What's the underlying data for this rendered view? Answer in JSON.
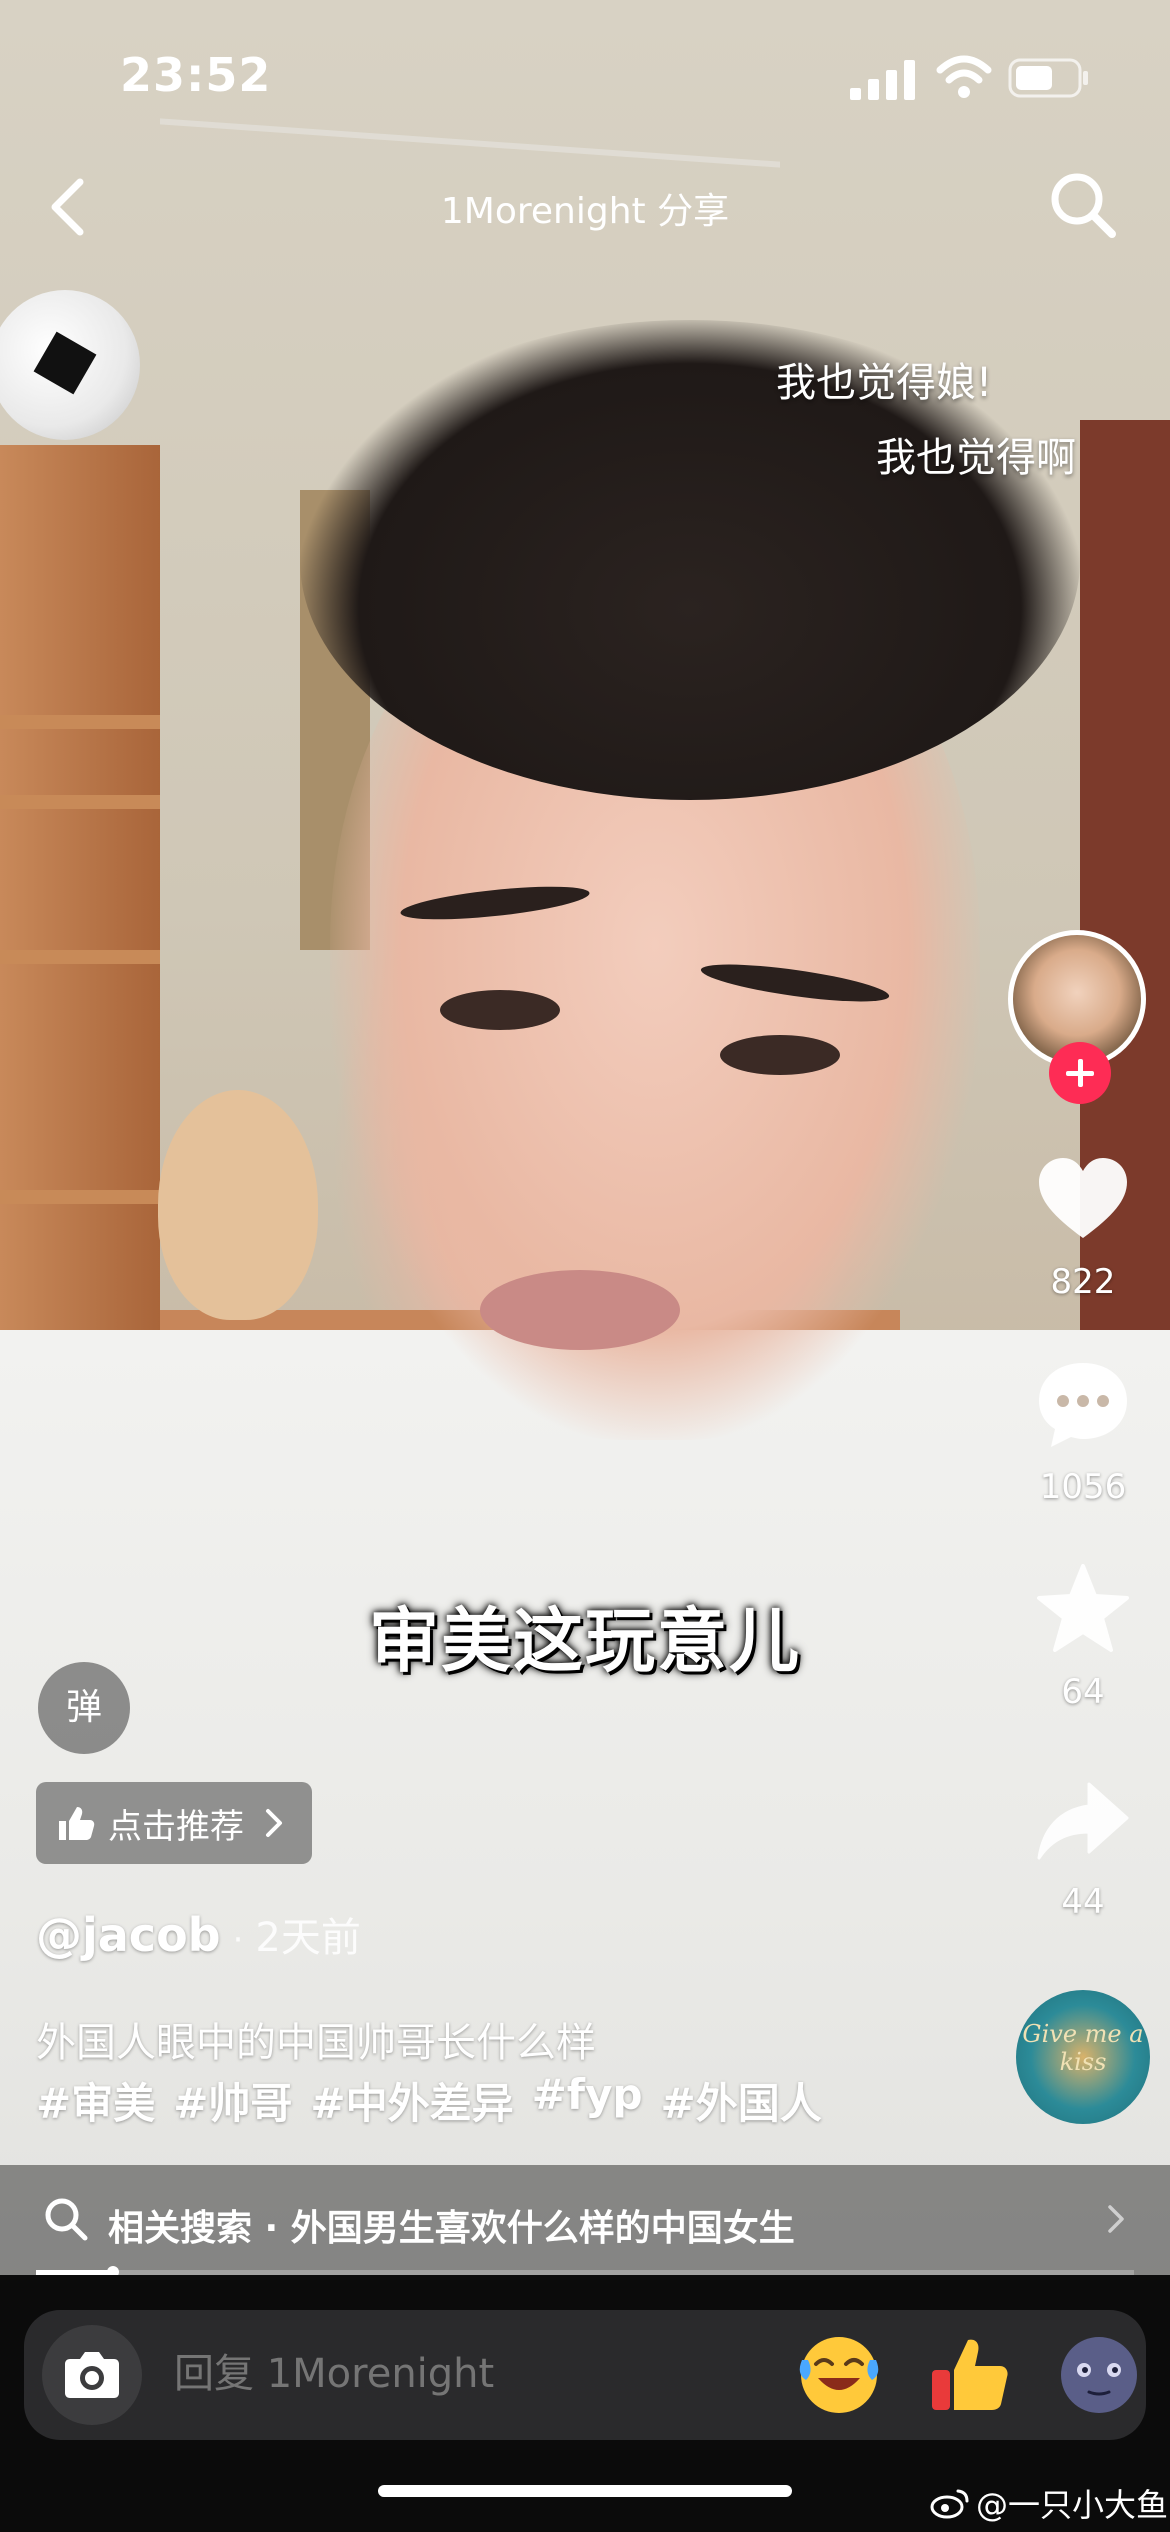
{
  "status_bar": {
    "time": "23:52"
  },
  "nav": {
    "title": "1Morenight 分享"
  },
  "danmaku": [
    "我也觉得娘!",
    "我也觉得啊"
  ],
  "subtitle": "审美这玩意儿",
  "rail": {
    "likes": "822",
    "comments": "1056",
    "favorites": "64",
    "shares": "44"
  },
  "music_disc_text": "Give me a kiss",
  "danmu_toggle_label": "弹",
  "recommend": {
    "label": "点击推荐"
  },
  "post": {
    "author": "@jacob",
    "separator": "·",
    "date": "2天前",
    "caption": "外国人眼中的中国帅哥长什么样",
    "hashtags": [
      "#审美",
      "#帅哥",
      "#中外差异",
      "#fyp",
      "#外国人"
    ]
  },
  "related_search": {
    "label": "相关搜索 · 外国男生喜欢什么样的中国女生"
  },
  "progress": {
    "fraction": 0.07
  },
  "reply": {
    "placeholder": "回复 1Morenight"
  },
  "emoji_shortcuts": [
    "laughing-crying-emoji",
    "thumbs-up-emoji",
    "new-moon-face-emoji"
  ],
  "watermark": "@一只小大鱼",
  "colors": {
    "follow": "#fe2c55",
    "bottom_bg": "#0b0b0b"
  }
}
